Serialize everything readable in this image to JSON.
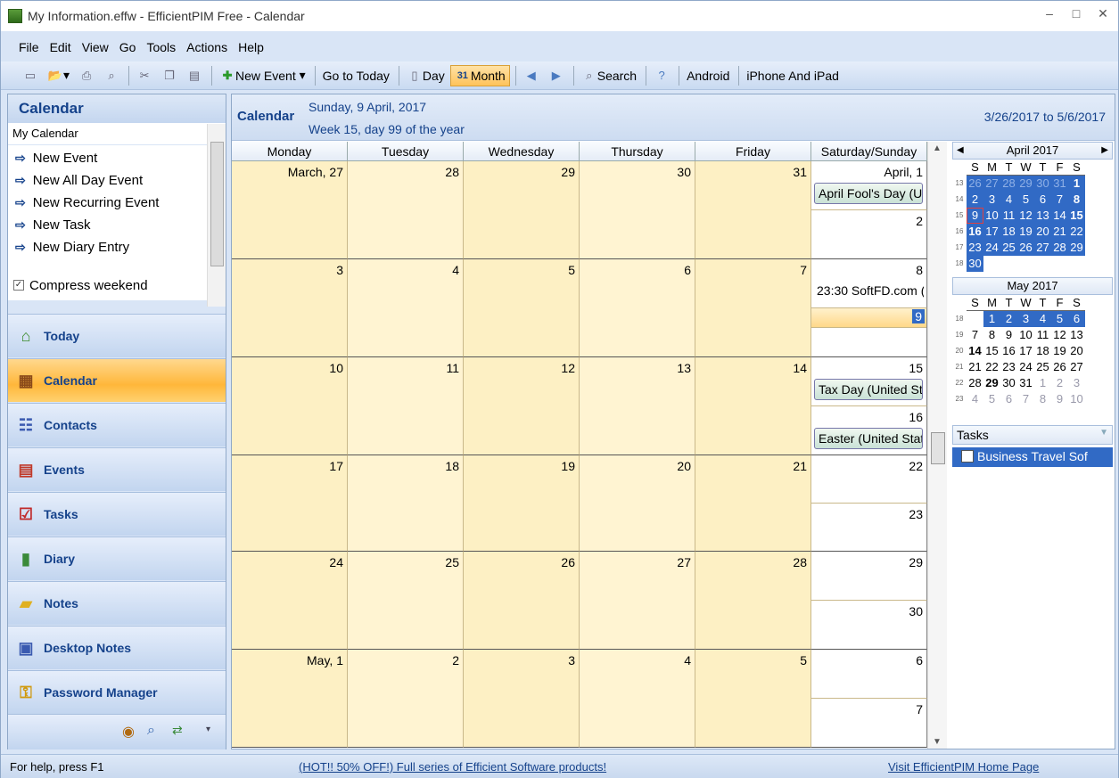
{
  "window": {
    "title": "My Information.effw - EfficientPIM Free - Calendar",
    "min": "–",
    "max": "□",
    "close": "✕"
  },
  "menu": [
    "File",
    "Edit",
    "View",
    "Go",
    "Tools",
    "Actions",
    "Help"
  ],
  "toolbar": {
    "new_event": "New Event",
    "go_to_today": "Go to Today",
    "day": "Day",
    "month": "Month",
    "search": "Search",
    "android": "Android",
    "iphone": "iPhone And iPad"
  },
  "left": {
    "header": "Calendar",
    "sub": "My Calendar",
    "actions": [
      "New Event",
      "New All Day Event",
      "New Recurring Event",
      "New Task",
      "New Diary Entry"
    ],
    "compress": "Compress weekend",
    "nav": [
      {
        "label": "Today",
        "icon": "home-icon"
      },
      {
        "label": "Calendar",
        "icon": "calendar-icon"
      },
      {
        "label": "Contacts",
        "icon": "contacts-icon"
      },
      {
        "label": "Events",
        "icon": "events-icon"
      },
      {
        "label": "Tasks",
        "icon": "tasks-icon"
      },
      {
        "label": "Diary",
        "icon": "diary-icon"
      },
      {
        "label": "Notes",
        "icon": "notes-icon"
      },
      {
        "label": "Desktop Notes",
        "icon": "desktop-notes-icon"
      },
      {
        "label": "Password Manager",
        "icon": "key-icon"
      }
    ]
  },
  "main": {
    "title": "Calendar",
    "date_line": "Sunday, 9 April, 2017",
    "week_line": "Week 15, day 99 of the year",
    "range": "3/26/2017 to 5/6/2017",
    "days": [
      "Monday",
      "Tuesday",
      "Wednesday",
      "Thursday",
      "Friday",
      "Saturday/Sunday"
    ],
    "weeks": [
      {
        "cells": [
          "March, 27",
          "28",
          "29",
          "30",
          "31"
        ],
        "sat": "April, 1",
        "sun": "2",
        "sat_events": [
          "April Fool's Day (Ur"
        ],
        "sun_events": []
      },
      {
        "cells": [
          "3",
          "4",
          "5",
          "6",
          "7"
        ],
        "sat": "8",
        "sun": "9",
        "sat_events": [
          "23:30 SoftFD.com ("
        ],
        "sun_events": []
      },
      {
        "cells": [
          "10",
          "11",
          "12",
          "13",
          "14"
        ],
        "sat": "15",
        "sun": "16",
        "sat_events": [
          "Tax Day (United St"
        ],
        "sun_events": [
          "Easter (United Stat"
        ]
      },
      {
        "cells": [
          "17",
          "18",
          "19",
          "20",
          "21"
        ],
        "sat": "22",
        "sun": "23",
        "sat_events": [],
        "sun_events": []
      },
      {
        "cells": [
          "24",
          "25",
          "26",
          "27",
          "28"
        ],
        "sat": "29",
        "sun": "30",
        "sat_events": [],
        "sun_events": []
      },
      {
        "cells": [
          "May, 1",
          "2",
          "3",
          "4",
          "5"
        ],
        "sat": "6",
        "sun": "7",
        "sat_events": [],
        "sun_events": []
      }
    ]
  },
  "mini_cals": [
    {
      "title": "April 2017",
      "dow": [
        "S",
        "M",
        "T",
        "W",
        "T",
        "F",
        "S"
      ],
      "rows": [
        {
          "wk": "13",
          "days": [
            "26",
            "27",
            "28",
            "29",
            "30",
            "31",
            "1"
          ]
        },
        {
          "wk": "14",
          "days": [
            "2",
            "3",
            "4",
            "5",
            "6",
            "7",
            "8"
          ]
        },
        {
          "wk": "15",
          "days": [
            "9",
            "10",
            "11",
            "12",
            "13",
            "14",
            "15"
          ]
        },
        {
          "wk": "16",
          "days": [
            "16",
            "17",
            "18",
            "19",
            "20",
            "21",
            "22"
          ]
        },
        {
          "wk": "17",
          "days": [
            "23",
            "24",
            "25",
            "26",
            "27",
            "28",
            "29"
          ]
        },
        {
          "wk": "18",
          "days": [
            "30",
            "",
            "",
            "",
            "",
            "",
            ""
          ]
        }
      ]
    },
    {
      "title": "May 2017",
      "dow": [
        "S",
        "M",
        "T",
        "W",
        "T",
        "F",
        "S"
      ],
      "rows": [
        {
          "wk": "18",
          "days": [
            "",
            "1",
            "2",
            "3",
            "4",
            "5",
            "6"
          ]
        },
        {
          "wk": "19",
          "days": [
            "7",
            "8",
            "9",
            "10",
            "11",
            "12",
            "13"
          ]
        },
        {
          "wk": "20",
          "days": [
            "14",
            "15",
            "16",
            "17",
            "18",
            "19",
            "20"
          ]
        },
        {
          "wk": "21",
          "days": [
            "21",
            "22",
            "23",
            "24",
            "25",
            "26",
            "27"
          ]
        },
        {
          "wk": "22",
          "days": [
            "28",
            "29",
            "30",
            "31",
            "1",
            "2",
            "3"
          ]
        },
        {
          "wk": "23",
          "days": [
            "4",
            "5",
            "6",
            "7",
            "8",
            "9",
            "10"
          ]
        }
      ]
    }
  ],
  "tasks": {
    "header": "Tasks",
    "items": [
      "Business Travel Sof"
    ]
  },
  "status": {
    "help": "For help, press F1",
    "promo": "(HOT!! 50% OFF!) Full series of Efficient Software products!",
    "home": "Visit EfficientPIM Home Page"
  },
  "colors": {
    "accent": "#316ac5",
    "header_text": "#15428b",
    "active_nav": "#ffb73a"
  }
}
